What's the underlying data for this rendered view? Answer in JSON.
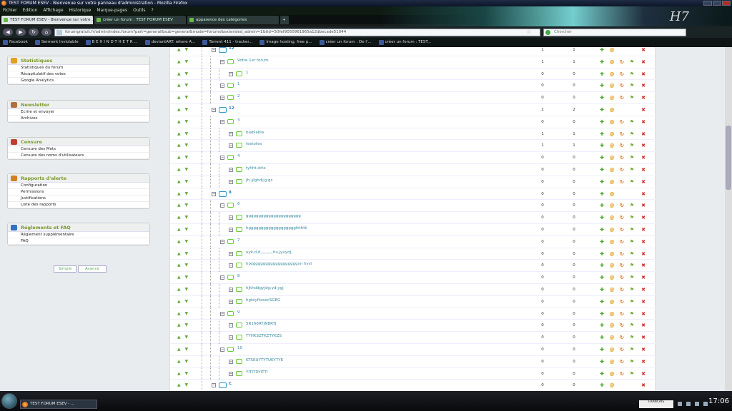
{
  "window": {
    "title": "TEST FORUM ESEV - Bienvenue sur votre panneau d'administration - Mozilla Firefox"
  },
  "menu": [
    "Fichier",
    "Edition",
    "Affichage",
    "Historique",
    "Marque-pages",
    "Outils",
    "?"
  ],
  "tabs": [
    {
      "label": "TEST FORUM ESEV - Bienvenue sur votre ...",
      "active": true
    },
    {
      "label": "créer un forum : TEST FORUM ESEV",
      "active": false
    },
    {
      "label": "apparence des catégories",
      "active": false
    }
  ],
  "banner_text": "H7",
  "nav": {
    "url": "forumgratuit.fr/admin/index.forum?part=general&sub=general&mode=forums&extended_admin=1&tid=50fef9050961965a12dbecade51044",
    "search_placeholder": "Chercher"
  },
  "bookmarks": [
    "Facebook",
    "Serment Inviolable",
    "B E H I N D T H E T R ...",
    "deviantART: where A...",
    "Torrent 411 - tracker...",
    "Image hosting, free p...",
    "créer un forum : De l'...",
    "créer un forum : TEST..."
  ],
  "sidebar": {
    "boxes": [
      {
        "title": "Statistiques",
        "items": [
          "Statistiques du forum",
          "Récapitulatif des votes",
          "Google Analytics"
        ]
      },
      {
        "title": "Newsletter",
        "items": [
          "Ecrire et envoyer",
          "Archives"
        ]
      },
      {
        "title": "Censure",
        "items": [
          "Censure des Mots",
          "Censure des noms d'utilisateurs"
        ]
      },
      {
        "title": "Rapports d'alerte",
        "items": [
          "Configuration",
          "Permissions",
          "Justifications",
          "Liste des rapports"
        ]
      },
      {
        "title": "Réglements et FAQ",
        "items": [
          "Réglement supplémentaire",
          "FAQ"
        ]
      }
    ],
    "mode_simple": "Simple",
    "mode_advanced": "Avancé"
  },
  "forums": [
    {
      "name": "12",
      "level": 1,
      "type": "cat",
      "topics": "1",
      "posts": "1",
      "actions": [
        "add",
        "edit",
        "del"
      ]
    },
    {
      "name": "Votre 1er forum",
      "level": 2,
      "type": "forum",
      "topics": "1",
      "posts": "1",
      "actions": [
        "add",
        "edit",
        "sync",
        "perm",
        "del"
      ]
    },
    {
      "name": "1",
      "level": 3,
      "type": "forum",
      "topics": "0",
      "posts": "0",
      "actions": [
        "add",
        "edit",
        "sync",
        "perm",
        "del"
      ]
    },
    {
      "name": "1",
      "level": 2,
      "type": "forum",
      "topics": "0",
      "posts": "0",
      "actions": [
        "add",
        "edit",
        "sync",
        "perm",
        "del"
      ]
    },
    {
      "name": "2",
      "level": 2,
      "type": "forum",
      "topics": "0",
      "posts": "0",
      "actions": [
        "add",
        "edit",
        "sync",
        "perm",
        "del"
      ]
    },
    {
      "name": "12",
      "level": 1,
      "type": "cat",
      "topics": "2",
      "posts": "2",
      "actions": [
        "add",
        "edit",
        "del"
      ]
    },
    {
      "name": "3",
      "level": 2,
      "type": "forum",
      "topics": "0",
      "posts": "0",
      "actions": [
        "add",
        "edit",
        "sync",
        "perm",
        "del"
      ]
    },
    {
      "name": "blablabla",
      "level": 3,
      "type": "forum",
      "topics": "1",
      "posts": "1",
      "actions": [
        "add",
        "edit",
        "sync",
        "perm",
        "del"
      ]
    },
    {
      "name": "testotes",
      "level": 3,
      "type": "forum",
      "topics": "1",
      "posts": "1",
      "actions": [
        "add",
        "edit",
        "sync",
        "perm",
        "del"
      ]
    },
    {
      "name": "4",
      "level": 2,
      "type": "forum",
      "topics": "0",
      "posts": "0",
      "actions": [
        "add",
        "edit",
        "sync",
        "perm",
        "del"
      ]
    },
    {
      "name": "tyhht,sths",
      "level": 3,
      "type": "forum",
      "topics": "0",
      "posts": "0",
      "actions": [
        "add",
        "edit",
        "sync",
        "perm",
        "del"
      ]
    },
    {
      "name": "jh;;jlghdj;g;gc",
      "level": 3,
      "type": "forum",
      "topics": "0",
      "posts": "0",
      "actions": [
        "add",
        "edit",
        "sync",
        "perm",
        "del"
      ]
    },
    {
      "name": "8",
      "level": 1,
      "type": "cat",
      "topics": "0",
      "posts": "0",
      "actions": [
        "add",
        "edit",
        "del"
      ]
    },
    {
      "name": "6",
      "level": 2,
      "type": "forum",
      "topics": "0",
      "posts": "0",
      "actions": [
        "add",
        "edit",
        "sync",
        "perm",
        "del"
      ]
    },
    {
      "name": "gggggggggggggggggggggg",
      "level": 3,
      "type": "forum",
      "topics": "0",
      "posts": "0",
      "actions": [
        "add",
        "edit",
        "sync",
        "perm",
        "del"
      ]
    },
    {
      "name": "hgggggggggggggggggggfsthtk",
      "level": 3,
      "type": "forum",
      "topics": "0",
      "posts": "0",
      "actions": [
        "add",
        "edit",
        "sync",
        "perm",
        "del"
      ]
    },
    {
      "name": "7",
      "level": 2,
      "type": "forum",
      "topics": "0",
      "posts": "0",
      "actions": [
        "add",
        "edit",
        "sync",
        "perm",
        "del"
      ]
    },
    {
      "name": "uyk,d,d,,,,,,,,,,hu,jyuydj,",
      "level": 3,
      "type": "forum",
      "topics": "0",
      "posts": "0",
      "actions": [
        "add",
        "edit",
        "sync",
        "perm",
        "del"
      ]
    },
    {
      "name": "hjxjggggggggggggggggggsn hyst",
      "level": 3,
      "type": "forum",
      "topics": "0",
      "posts": "0",
      "actions": [
        "add",
        "edit",
        "sync",
        "perm",
        "del"
      ]
    },
    {
      "name": "8",
      "level": 2,
      "type": "forum",
      "topics": "0",
      "posts": "0",
      "actions": [
        "add",
        "edit",
        "sync",
        "perm",
        "del"
      ]
    },
    {
      "name": "hjkhddgyjdg;yd;ygj",
      "level": 3,
      "type": "forum",
      "topics": "0",
      "posts": "0",
      "actions": [
        "add",
        "edit",
        "sync",
        "perm",
        "del"
      ]
    },
    {
      "name": "hgteyfkzsxcSGEG",
      "level": 3,
      "type": "forum",
      "topics": "0",
      "posts": "0",
      "actions": [
        "add",
        "edit",
        "sync",
        "perm",
        "del"
      ]
    },
    {
      "name": "9",
      "level": 2,
      "type": "forum",
      "topics": "0",
      "posts": "0",
      "actions": [
        "add",
        "edit",
        "sync",
        "perm",
        "del"
      ]
    },
    {
      "name": "5R166RTJNBRTJ",
      "level": 3,
      "type": "forum",
      "topics": "0",
      "posts": "0",
      "actions": [
        "add",
        "edit",
        "sync",
        "perm",
        "del"
      ]
    },
    {
      "name": "TYHKSZTKZTYKZS",
      "level": 3,
      "type": "forum",
      "topics": "0",
      "posts": "0",
      "actions": [
        "add",
        "edit",
        "sync",
        "perm",
        "del"
      ]
    },
    {
      "name": "10",
      "level": 2,
      "type": "forum",
      "topics": "0",
      "posts": "0",
      "actions": [
        "add",
        "edit",
        "sync",
        "perm",
        "del"
      ]
    },
    {
      "name": "KTSKUYTYTUKY7YE",
      "level": 3,
      "type": "forum",
      "topics": "0",
      "posts": "0",
      "actions": [
        "add",
        "edit",
        "sync",
        "perm",
        "del"
      ]
    },
    {
      "name": "YITITDYITTI",
      "level": 3,
      "type": "forum",
      "topics": "0",
      "posts": "0",
      "actions": [
        "add",
        "edit",
        "sync",
        "perm",
        "del"
      ]
    },
    {
      "name": "C",
      "level": 1,
      "type": "cat",
      "topics": "0",
      "posts": "0",
      "actions": [
        "add",
        "edit",
        "del"
      ]
    }
  ],
  "taskbar": {
    "item": "TEST FORUM ESEV - ...",
    "time": "17:06",
    "lang": "FRANCAIS"
  },
  "colors": {
    "accent": "#7a9a2a",
    "link": "#3a8aa0",
    "delete": "#cc3333"
  }
}
